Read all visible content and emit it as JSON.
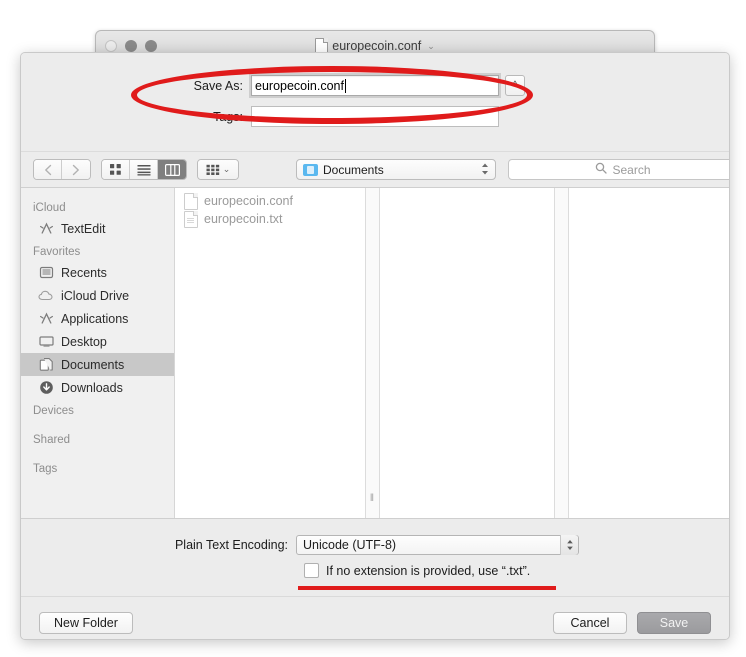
{
  "background_window": {
    "title": "europecoin.conf",
    "title_icon": "document-icon",
    "title_chevron": "⌄",
    "traffic_lights": [
      "close",
      "minimize",
      "maximize"
    ]
  },
  "save_sheet": {
    "save_as": {
      "label": "Save As:",
      "value": "europecoin.conf",
      "placeholder": ""
    },
    "tags": {
      "label": "Tags:",
      "value": "",
      "placeholder": ""
    },
    "disclosure_button": "^"
  },
  "toolbar": {
    "back": "‹",
    "forward": "›",
    "view_modes": [
      {
        "name": "icon-view",
        "selected": false
      },
      {
        "name": "list-view",
        "selected": false
      },
      {
        "name": "column-view",
        "selected": true
      }
    ],
    "arrange_chevron": "⌄",
    "path_popup": {
      "label": "Documents",
      "icon": "blue-folder-icon",
      "arrows": "⌃⌄"
    },
    "search": {
      "placeholder": "Search",
      "icon": "search-icon"
    }
  },
  "sidebar": {
    "sections": [
      {
        "header": "iCloud",
        "items": [
          {
            "label": "TextEdit",
            "icon": "applications-a-icon",
            "selected": false
          }
        ]
      },
      {
        "header": "Favorites",
        "items": [
          {
            "label": "Recents",
            "icon": "recents-clock-icon",
            "selected": false
          },
          {
            "label": "iCloud Drive",
            "icon": "cloud-icon",
            "selected": false
          },
          {
            "label": "Applications",
            "icon": "applications-a-icon",
            "selected": false
          },
          {
            "label": "Desktop",
            "icon": "desktop-monitor-icon",
            "selected": false
          },
          {
            "label": "Documents",
            "icon": "documents-pages-icon",
            "selected": true
          },
          {
            "label": "Downloads",
            "icon": "downloads-arrow-icon",
            "selected": false
          }
        ]
      },
      {
        "header": "Devices",
        "items": []
      },
      {
        "header": "Shared",
        "items": []
      },
      {
        "header": "Tags",
        "items": []
      }
    ]
  },
  "file_list": {
    "files": [
      {
        "name": "europecoin.conf",
        "icon": "blank-document-icon"
      },
      {
        "name": "europecoin.txt",
        "icon": "text-document-icon"
      }
    ],
    "resize_grip": "‖"
  },
  "accessory": {
    "encoding_label": "Plain Text Encoding:",
    "encoding_value": "Unicode (UTF-8)",
    "encoding_arrows": "⌃⌄",
    "extension_checkbox": {
      "label": "If no extension is provided, use “.txt”.",
      "checked": false
    }
  },
  "buttons": {
    "new_folder": "New Folder",
    "cancel": "Cancel",
    "save": "Save"
  },
  "annotations": {
    "ellipse_target": "save-as-field",
    "underline_target": "extension-checkbox-row",
    "color": "#e01b1b"
  }
}
